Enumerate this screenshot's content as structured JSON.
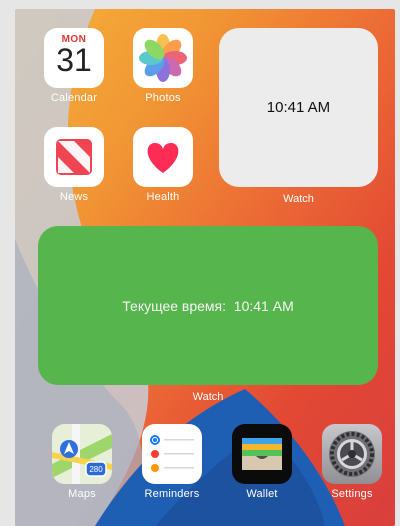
{
  "apps": {
    "calendar": {
      "label": "Calendar",
      "month": "MON",
      "day": "31"
    },
    "photos": {
      "label": "Photos"
    },
    "news": {
      "label": "News"
    },
    "health": {
      "label": "Health"
    },
    "maps": {
      "label": "Maps",
      "route_badge": "280"
    },
    "reminders": {
      "label": "Reminders"
    },
    "wallet": {
      "label": "Wallet"
    },
    "settings": {
      "label": "Settings"
    }
  },
  "widgets": {
    "watch_small": {
      "time": "10:41 AM",
      "label": "Watch"
    },
    "watch_large": {
      "text": "Текущее время:  10:41 AM",
      "label": "Watch",
      "color": "#57b54e"
    }
  },
  "colors": {
    "news_red": "#f04452",
    "health_heart": "#ff2d55",
    "maps_shield": "#2b6ad8"
  }
}
